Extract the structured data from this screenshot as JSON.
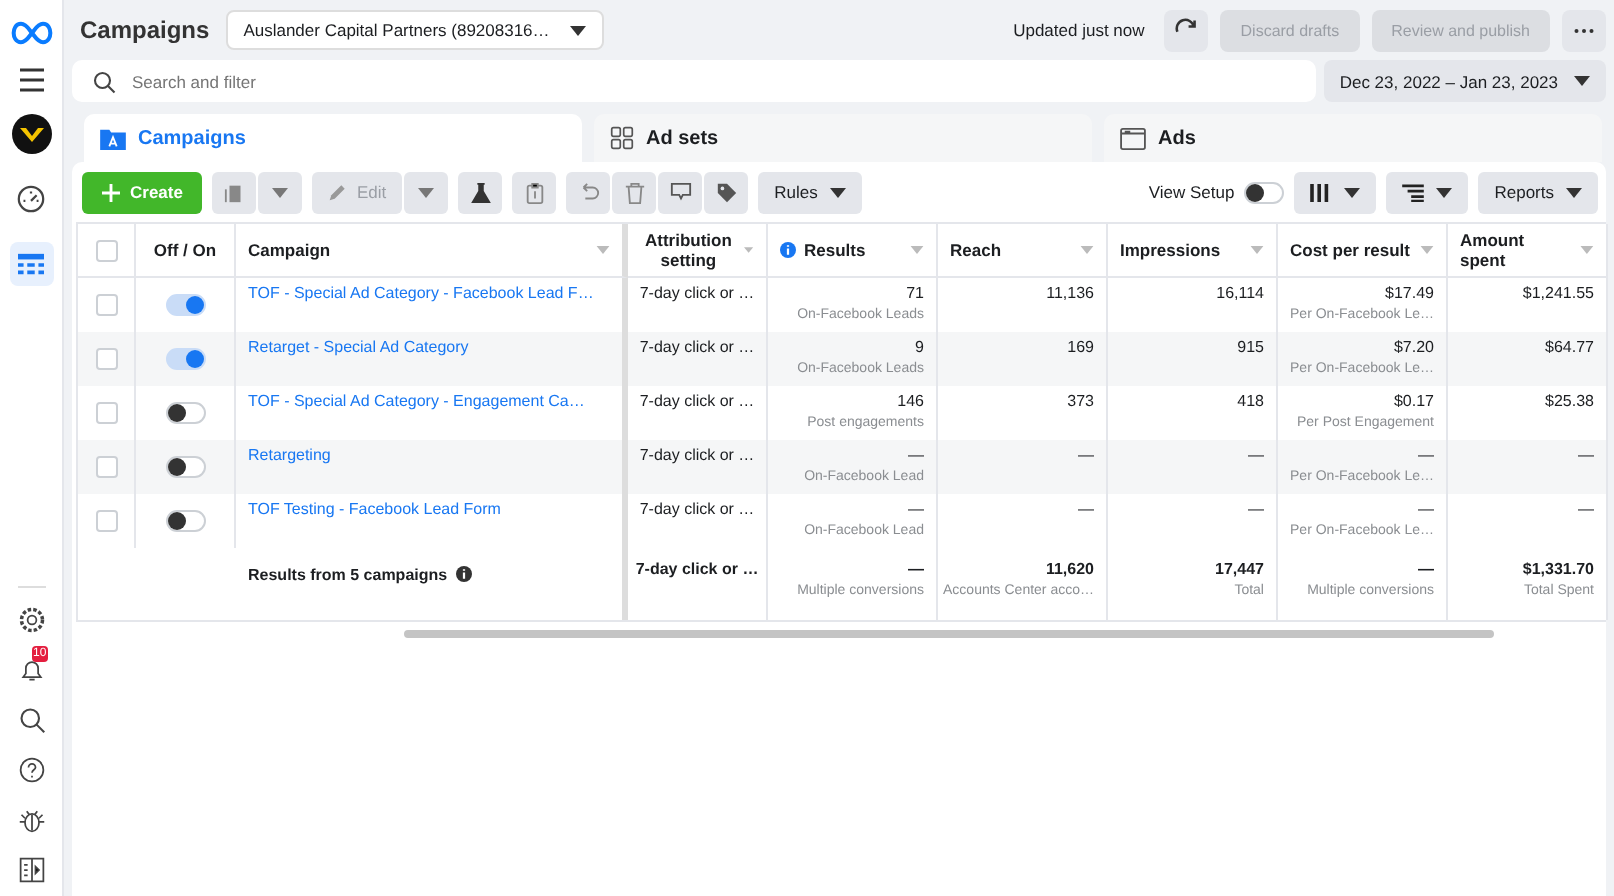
{
  "sidebar": {
    "items": [
      {
        "kind": "dashboard",
        "selected": false
      },
      {
        "kind": "table",
        "selected": true
      }
    ],
    "bottom": [
      {
        "kind": "settings"
      },
      {
        "kind": "bell",
        "badge": "10"
      },
      {
        "kind": "search"
      },
      {
        "kind": "help"
      },
      {
        "kind": "bug"
      },
      {
        "kind": "panel"
      }
    ]
  },
  "header": {
    "title": "Campaigns",
    "account": "Auslander Capital Partners (89208316…",
    "updated": "Updated just now",
    "buttons": [
      {
        "label": "Discard drafts",
        "disabled": true
      },
      {
        "label": "Review and publish",
        "disabled": true
      }
    ]
  },
  "search": {
    "placeholder": "Search and filter"
  },
  "date_range": "Dec 23, 2022 – Jan 23, 2023",
  "tabs": [
    {
      "label": "Campaigns",
      "kind": "folder",
      "selected": true
    },
    {
      "label": "Ad sets",
      "kind": "grid",
      "selected": false
    },
    {
      "label": "Ads",
      "kind": "window",
      "selected": false
    }
  ],
  "toolbar": {
    "create": "Create",
    "edit": {
      "label": "Edit",
      "disabled": true
    },
    "rules": "Rules",
    "view_setup": {
      "label": "View Setup",
      "on": false
    },
    "reports": "Reports"
  },
  "table": {
    "select_all_checked": false,
    "columns": [
      {
        "label": "Off / On"
      },
      {
        "label": "Campaign",
        "info": false
      },
      {
        "label": "Attribution setting",
        "info": false
      },
      {
        "label": "Results",
        "info": true
      },
      {
        "label": "Reach",
        "info": false
      },
      {
        "label": "Impressions",
        "info": false
      },
      {
        "label": "Cost per result",
        "info": false
      },
      {
        "label": "Amount spent",
        "info": false
      }
    ],
    "rows": [
      {
        "checked": false,
        "on": true,
        "name": "TOF - Special Ad Category - Facebook Lead F…",
        "attribution": "7-day click or …",
        "metrics": [
          {
            "value": "71",
            "sub": "On-Facebook Leads"
          },
          {
            "value": "11,136"
          },
          {
            "value": "16,114"
          },
          {
            "value": "$17.49",
            "sub": "Per On-Facebook Le…"
          },
          {
            "value": "$1,241.55"
          }
        ]
      },
      {
        "checked": false,
        "on": true,
        "name": "Retarget - Special Ad Category",
        "attribution": "7-day click or …",
        "metrics": [
          {
            "value": "9",
            "sub": "On-Facebook Leads"
          },
          {
            "value": "169"
          },
          {
            "value": "915"
          },
          {
            "value": "$7.20",
            "sub": "Per On-Facebook Le…"
          },
          {
            "value": "$64.77"
          }
        ]
      },
      {
        "checked": false,
        "on": false,
        "name": "TOF - Special Ad Category - Engagement Ca…",
        "attribution": "7-day click or …",
        "metrics": [
          {
            "value": "146",
            "sub": "Post engagements"
          },
          {
            "value": "373"
          },
          {
            "value": "418"
          },
          {
            "value": "$0.17",
            "sub": "Per Post Engagement"
          },
          {
            "value": "$25.38"
          }
        ]
      },
      {
        "checked": false,
        "on": false,
        "name": "Retargeting",
        "attribution": "7-day click or …",
        "metrics": [
          {
            "value": "—",
            "sub": "On-Facebook Lead"
          },
          {
            "value": "—"
          },
          {
            "value": "—"
          },
          {
            "value": "—",
            "sub": "Per On-Facebook Le…"
          },
          {
            "value": "—"
          }
        ]
      },
      {
        "checked": false,
        "on": false,
        "name": "TOF Testing - Facebook Lead Form",
        "attribution": "7-day click or …",
        "metrics": [
          {
            "value": "—",
            "sub": "On-Facebook Lead"
          },
          {
            "value": "—"
          },
          {
            "value": "—"
          },
          {
            "value": "—",
            "sub": "Per On-Facebook Le…"
          },
          {
            "value": "—"
          }
        ]
      }
    ],
    "summary": {
      "label": "Results from 5 campaigns",
      "attribution": "7-day click or …",
      "metrics": [
        {
          "value": "—",
          "sub": "Multiple conversions"
        },
        {
          "value": "11,620",
          "sub": "Accounts Center acco…"
        },
        {
          "value": "17,447",
          "sub": "Total"
        },
        {
          "value": "—",
          "sub": "Multiple conversions"
        },
        {
          "value": "$1,331.70",
          "sub": "Total Spent"
        }
      ]
    }
  }
}
